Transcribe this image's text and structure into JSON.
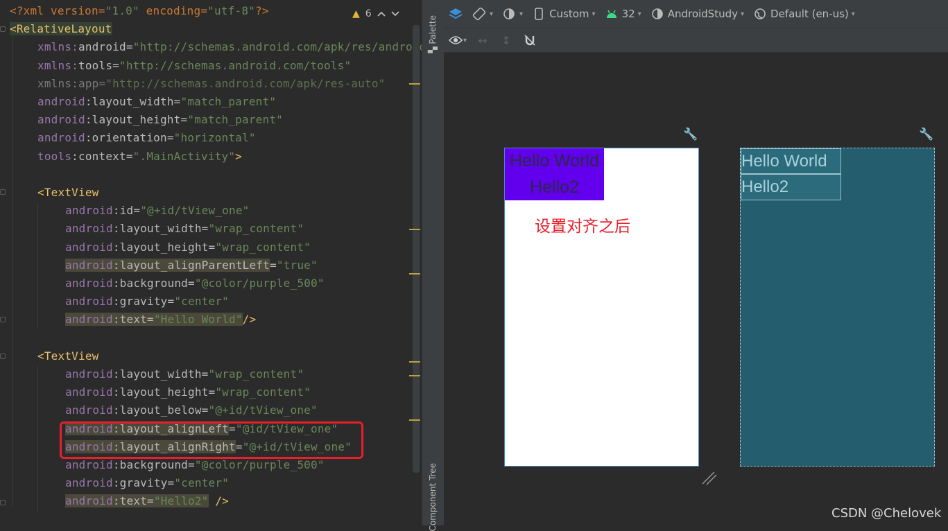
{
  "editor": {
    "lines": [
      {
        "indent": 0,
        "tokens": [
          [
            "pi",
            "<?xml version="
          ],
          [
            "val",
            "\"1.0\""
          ],
          [
            "pi",
            " encoding="
          ],
          [
            "val",
            "\"utf-8\""
          ],
          [
            "pi",
            "?>"
          ]
        ]
      },
      {
        "indent": 0,
        "tokens": [
          [
            "taghl",
            "<RelativeLayout"
          ]
        ]
      },
      {
        "indent": 1,
        "tokens": [
          [
            "ns",
            "xmlns:"
          ],
          [
            "attr",
            "android"
          ],
          [
            "attr",
            "="
          ],
          [
            "val",
            "\"http://schemas.android.com/apk/res/android\""
          ]
        ]
      },
      {
        "indent": 1,
        "tokens": [
          [
            "ns",
            "xmlns:"
          ],
          [
            "attr",
            "tools"
          ],
          [
            "attr",
            "="
          ],
          [
            "val",
            "\"http://schemas.android.com/tools\""
          ]
        ]
      },
      {
        "indent": 1,
        "tokens": [
          [
            "dim",
            "xmlns:app="
          ],
          [
            "dimval",
            "\"http://schemas.android.com/apk/res-auto\""
          ]
        ]
      },
      {
        "indent": 1,
        "tokens": [
          [
            "ns",
            "android"
          ],
          [
            "attr",
            ":layout_width="
          ],
          [
            "val",
            "\"match_parent\""
          ]
        ]
      },
      {
        "indent": 1,
        "tokens": [
          [
            "ns",
            "android"
          ],
          [
            "attr",
            ":layout_height="
          ],
          [
            "val",
            "\"match_parent\""
          ]
        ]
      },
      {
        "indent": 1,
        "tokens": [
          [
            "ns",
            "android"
          ],
          [
            "attr",
            ":orientation="
          ],
          [
            "val",
            "\"horizontal\""
          ]
        ]
      },
      {
        "indent": 1,
        "tokens": [
          [
            "ns",
            "tools"
          ],
          [
            "attr",
            ":context="
          ],
          [
            "val",
            "\".MainActivity\""
          ],
          [
            "tag",
            ">"
          ]
        ]
      },
      {
        "indent": 0,
        "tokens": []
      },
      {
        "indent": 1,
        "tokens": [
          [
            "tag",
            "<TextView"
          ]
        ]
      },
      {
        "indent": 2,
        "tokens": [
          [
            "ns",
            "android"
          ],
          [
            "attr",
            ":id="
          ],
          [
            "val",
            "\"@+id/tView_one\""
          ]
        ]
      },
      {
        "indent": 2,
        "tokens": [
          [
            "ns",
            "android"
          ],
          [
            "attr",
            ":layout_width="
          ],
          [
            "val",
            "\"wrap_content\""
          ]
        ]
      },
      {
        "indent": 2,
        "tokens": [
          [
            "ns",
            "android"
          ],
          [
            "attr",
            ":layout_height="
          ],
          [
            "val",
            "\"wrap_content\""
          ]
        ]
      },
      {
        "indent": 2,
        "tokens": [
          [
            "nshl",
            "android"
          ],
          [
            "attrhl",
            ":layout_alignParentLeft"
          ],
          [
            "attr",
            "="
          ],
          [
            "val",
            "\"true\""
          ]
        ]
      },
      {
        "indent": 2,
        "tokens": [
          [
            "ns",
            "android"
          ],
          [
            "attr",
            ":background="
          ],
          [
            "val",
            "\"@color/purple_500\""
          ]
        ]
      },
      {
        "indent": 2,
        "tokens": [
          [
            "ns",
            "android"
          ],
          [
            "attr",
            ":gravity="
          ],
          [
            "val",
            "\"center\""
          ]
        ]
      },
      {
        "indent": 2,
        "tokens": [
          [
            "nshl",
            "android"
          ],
          [
            "attrhl",
            ":text="
          ],
          [
            "valhl",
            "\"Hello World\""
          ],
          [
            "tag",
            "/>"
          ]
        ]
      },
      {
        "indent": 0,
        "tokens": []
      },
      {
        "indent": 1,
        "tokens": [
          [
            "tag",
            "<TextView"
          ]
        ]
      },
      {
        "indent": 2,
        "tokens": [
          [
            "ns",
            "android"
          ],
          [
            "attr",
            ":layout_width="
          ],
          [
            "val",
            "\"wrap_content\""
          ]
        ]
      },
      {
        "indent": 2,
        "tokens": [
          [
            "ns",
            "android"
          ],
          [
            "attr",
            ":layout_height="
          ],
          [
            "val",
            "\"wrap_content\""
          ]
        ]
      },
      {
        "indent": 2,
        "tokens": [
          [
            "ns",
            "android"
          ],
          [
            "attr",
            ":layout_below="
          ],
          [
            "val",
            "\"@+id/tView_one\""
          ]
        ]
      },
      {
        "indent": 2,
        "tokens": [
          [
            "nshl",
            "android"
          ],
          [
            "attrhl",
            ":layout_alignLeft"
          ],
          [
            "attr",
            "="
          ],
          [
            "val",
            "\"@id/tView_one\""
          ]
        ]
      },
      {
        "indent": 2,
        "tokens": [
          [
            "nshl",
            "android"
          ],
          [
            "attrhl",
            ":layout_alignRight"
          ],
          [
            "attr",
            "="
          ],
          [
            "val",
            "\"@+id/tView_one\""
          ]
        ]
      },
      {
        "indent": 2,
        "tokens": [
          [
            "ns",
            "android"
          ],
          [
            "attr",
            ":background="
          ],
          [
            "val",
            "\"@color/purple_500\""
          ]
        ]
      },
      {
        "indent": 2,
        "tokens": [
          [
            "ns",
            "android"
          ],
          [
            "attr",
            ":gravity="
          ],
          [
            "val",
            "\"center\""
          ]
        ]
      },
      {
        "indent": 2,
        "tokens": [
          [
            "nshl",
            "android"
          ],
          [
            "attrhl",
            ":text="
          ],
          [
            "valhl",
            "\"Hello2\""
          ],
          [
            "tag",
            " />"
          ]
        ]
      }
    ],
    "warnings": "6"
  },
  "side_strip": {
    "palette": "Palette",
    "component_tree": "Component Tree"
  },
  "toolbar": {
    "device": "Custom",
    "api": "32",
    "theme": "AndroidStudy",
    "locale": "Default (en-us)"
  },
  "preview": {
    "tv1_text": "Hello World",
    "tv2_text": "Hello2",
    "annotation": "设置对齐之后",
    "purple": "#6200ee"
  },
  "watermark": "CSDN @Chelovek"
}
